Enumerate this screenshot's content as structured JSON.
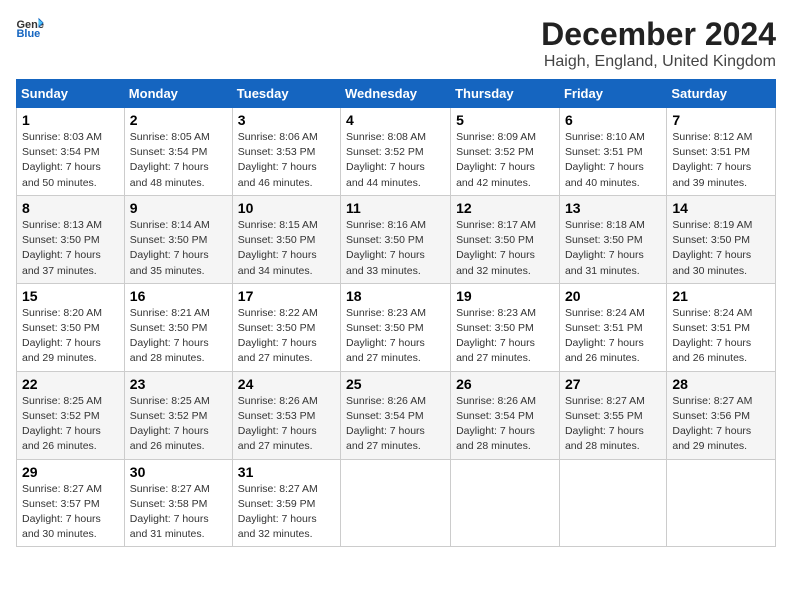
{
  "logo": {
    "text_general": "General",
    "text_blue": "Blue"
  },
  "title": "December 2024",
  "location": "Haigh, England, United Kingdom",
  "days_of_week": [
    "Sunday",
    "Monday",
    "Tuesday",
    "Wednesday",
    "Thursday",
    "Friday",
    "Saturday"
  ],
  "weeks": [
    [
      {
        "day": 1,
        "sunrise": "8:03 AM",
        "sunset": "3:54 PM",
        "daylight": "7 hours and 50 minutes."
      },
      {
        "day": 2,
        "sunrise": "8:05 AM",
        "sunset": "3:54 PM",
        "daylight": "7 hours and 48 minutes."
      },
      {
        "day": 3,
        "sunrise": "8:06 AM",
        "sunset": "3:53 PM",
        "daylight": "7 hours and 46 minutes."
      },
      {
        "day": 4,
        "sunrise": "8:08 AM",
        "sunset": "3:52 PM",
        "daylight": "7 hours and 44 minutes."
      },
      {
        "day": 5,
        "sunrise": "8:09 AM",
        "sunset": "3:52 PM",
        "daylight": "7 hours and 42 minutes."
      },
      {
        "day": 6,
        "sunrise": "8:10 AM",
        "sunset": "3:51 PM",
        "daylight": "7 hours and 40 minutes."
      },
      {
        "day": 7,
        "sunrise": "8:12 AM",
        "sunset": "3:51 PM",
        "daylight": "7 hours and 39 minutes."
      }
    ],
    [
      {
        "day": 8,
        "sunrise": "8:13 AM",
        "sunset": "3:50 PM",
        "daylight": "7 hours and 37 minutes."
      },
      {
        "day": 9,
        "sunrise": "8:14 AM",
        "sunset": "3:50 PM",
        "daylight": "7 hours and 35 minutes."
      },
      {
        "day": 10,
        "sunrise": "8:15 AM",
        "sunset": "3:50 PM",
        "daylight": "7 hours and 34 minutes."
      },
      {
        "day": 11,
        "sunrise": "8:16 AM",
        "sunset": "3:50 PM",
        "daylight": "7 hours and 33 minutes."
      },
      {
        "day": 12,
        "sunrise": "8:17 AM",
        "sunset": "3:50 PM",
        "daylight": "7 hours and 32 minutes."
      },
      {
        "day": 13,
        "sunrise": "8:18 AM",
        "sunset": "3:50 PM",
        "daylight": "7 hours and 31 minutes."
      },
      {
        "day": 14,
        "sunrise": "8:19 AM",
        "sunset": "3:50 PM",
        "daylight": "7 hours and 30 minutes."
      }
    ],
    [
      {
        "day": 15,
        "sunrise": "8:20 AM",
        "sunset": "3:50 PM",
        "daylight": "7 hours and 29 minutes."
      },
      {
        "day": 16,
        "sunrise": "8:21 AM",
        "sunset": "3:50 PM",
        "daylight": "7 hours and 28 minutes."
      },
      {
        "day": 17,
        "sunrise": "8:22 AM",
        "sunset": "3:50 PM",
        "daylight": "7 hours and 27 minutes."
      },
      {
        "day": 18,
        "sunrise": "8:23 AM",
        "sunset": "3:50 PM",
        "daylight": "7 hours and 27 minutes."
      },
      {
        "day": 19,
        "sunrise": "8:23 AM",
        "sunset": "3:50 PM",
        "daylight": "7 hours and 27 minutes."
      },
      {
        "day": 20,
        "sunrise": "8:24 AM",
        "sunset": "3:51 PM",
        "daylight": "7 hours and 26 minutes."
      },
      {
        "day": 21,
        "sunrise": "8:24 AM",
        "sunset": "3:51 PM",
        "daylight": "7 hours and 26 minutes."
      }
    ],
    [
      {
        "day": 22,
        "sunrise": "8:25 AM",
        "sunset": "3:52 PM",
        "daylight": "7 hours and 26 minutes."
      },
      {
        "day": 23,
        "sunrise": "8:25 AM",
        "sunset": "3:52 PM",
        "daylight": "7 hours and 26 minutes."
      },
      {
        "day": 24,
        "sunrise": "8:26 AM",
        "sunset": "3:53 PM",
        "daylight": "7 hours and 27 minutes."
      },
      {
        "day": 25,
        "sunrise": "8:26 AM",
        "sunset": "3:54 PM",
        "daylight": "7 hours and 27 minutes."
      },
      {
        "day": 26,
        "sunrise": "8:26 AM",
        "sunset": "3:54 PM",
        "daylight": "7 hours and 28 minutes."
      },
      {
        "day": 27,
        "sunrise": "8:27 AM",
        "sunset": "3:55 PM",
        "daylight": "7 hours and 28 minutes."
      },
      {
        "day": 28,
        "sunrise": "8:27 AM",
        "sunset": "3:56 PM",
        "daylight": "7 hours and 29 minutes."
      }
    ],
    [
      {
        "day": 29,
        "sunrise": "8:27 AM",
        "sunset": "3:57 PM",
        "daylight": "7 hours and 30 minutes."
      },
      {
        "day": 30,
        "sunrise": "8:27 AM",
        "sunset": "3:58 PM",
        "daylight": "7 hours and 31 minutes."
      },
      {
        "day": 31,
        "sunrise": "8:27 AM",
        "sunset": "3:59 PM",
        "daylight": "7 hours and 32 minutes."
      },
      null,
      null,
      null,
      null
    ]
  ]
}
